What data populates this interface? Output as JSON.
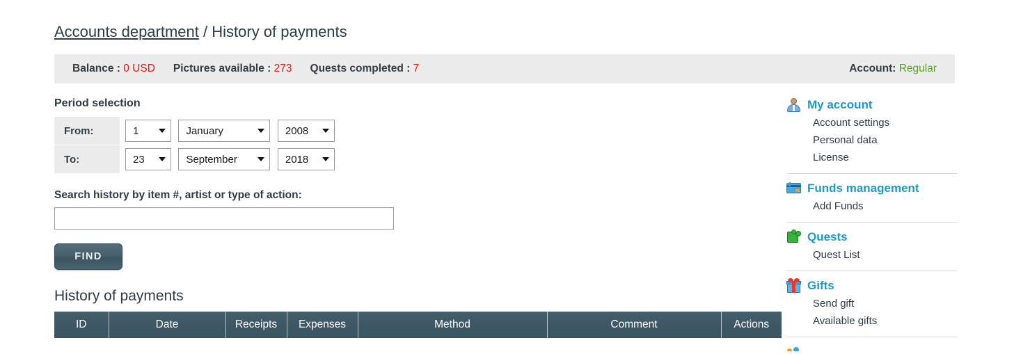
{
  "breadcrumb": {
    "parent": "Accounts department",
    "separator": "/",
    "current": "History of payments"
  },
  "statusbar": {
    "balance_label": "Balance :",
    "balance_value": "0 USD",
    "pictures_label": "Pictures available :",
    "pictures_value": "273",
    "quests_label": "Quests completed :",
    "quests_value": "7",
    "account_label": "Account:",
    "account_value": "Regular",
    "value_color": "#e01b1b",
    "account_color": "#5a9e2f",
    "background": "#ececec"
  },
  "period": {
    "title": "Period selection",
    "from_label": "From:",
    "to_label": "To:",
    "from": {
      "day": "1",
      "month": "January",
      "year": "2008"
    },
    "to": {
      "day": "23",
      "month": "September",
      "year": "2018"
    }
  },
  "search": {
    "label": "Search history by item #, artist or type of action:",
    "value": "",
    "placeholder": "",
    "button_label": "FIND"
  },
  "history": {
    "title": "History of payments",
    "columns": [
      "ID",
      "Date",
      "Receipts",
      "Expenses",
      "Method",
      "Comment",
      "Actions"
    ],
    "rows": []
  },
  "sidebar": {
    "groups": [
      {
        "icon": "person-icon",
        "title": "My account",
        "links": [
          "Account settings",
          "Personal data",
          "License"
        ]
      },
      {
        "icon": "card-icon",
        "title": "Funds management",
        "links": [
          "Add Funds"
        ]
      },
      {
        "icon": "puzzle-icon",
        "title": "Quests",
        "links": [
          "Quest List"
        ]
      },
      {
        "icon": "gift-icon",
        "title": "Gifts",
        "links": [
          "Send gift",
          "Available gifts"
        ]
      },
      {
        "icon": "people-icon",
        "title": "",
        "links": []
      }
    ],
    "heading_color": "#1b9ad1"
  }
}
